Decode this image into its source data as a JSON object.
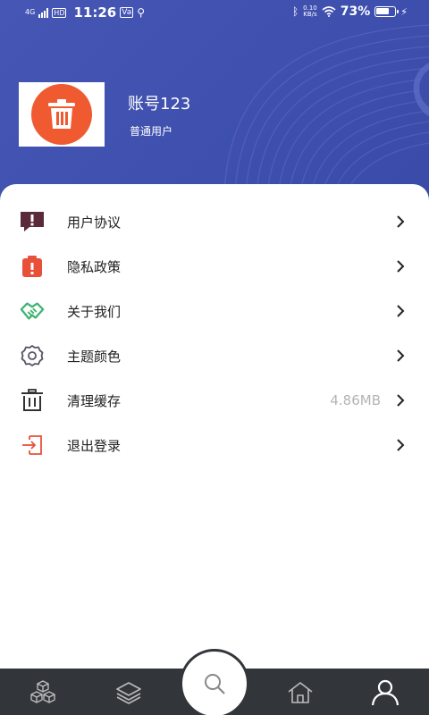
{
  "status_bar": {
    "network": "4G",
    "hd": "HD",
    "time": "11:26",
    "notif_badge": "Va",
    "speed_value": "0.10",
    "speed_unit": "KB/s",
    "battery_percent": "73%",
    "battery_level": 0.73
  },
  "profile": {
    "username": "账号123",
    "user_type": "普通用户",
    "avatar_icon": "trash-bin-icon"
  },
  "menu": {
    "items": [
      {
        "label": "用户协议",
        "icon": "user-agreement-icon",
        "value": ""
      },
      {
        "label": "隐私政策",
        "icon": "privacy-policy-icon",
        "value": ""
      },
      {
        "label": "关于我们",
        "icon": "handshake-icon",
        "value": ""
      },
      {
        "label": "主题颜色",
        "icon": "gear-icon",
        "value": ""
      },
      {
        "label": "清理缓存",
        "icon": "trash-icon",
        "value": "4.86MB"
      },
      {
        "label": "退出登录",
        "icon": "logout-icon",
        "value": ""
      }
    ]
  },
  "bottom_nav": {
    "items": [
      "cubes-icon",
      "layers-icon",
      "search-icon",
      "home-icon",
      "user-icon"
    ],
    "active": "user-icon"
  },
  "colors": {
    "header_bg": "#4151b0",
    "avatar_circle": "#f05a31",
    "nav_bg": "#32363b",
    "danger": "#e8503a",
    "agreement": "#5a2a3a",
    "about": "#3cb371"
  }
}
